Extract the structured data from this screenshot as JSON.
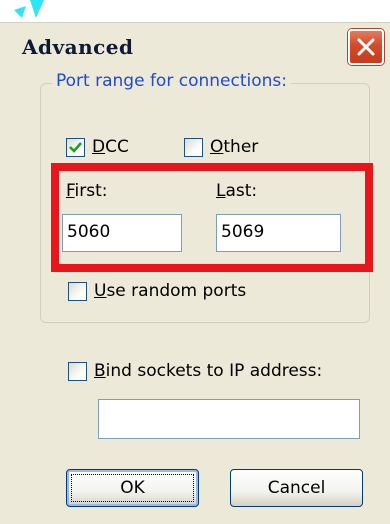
{
  "dialog": {
    "title": "Advanced"
  },
  "port_group": {
    "legend": "Port range for connections:",
    "dcc": {
      "prefix": "",
      "accel": "D",
      "rest": "CC",
      "checked": true
    },
    "other": {
      "accel": "O",
      "rest": "ther",
      "checked": false
    },
    "first": {
      "accel": "F",
      "rest": "irst:",
      "value": "5060"
    },
    "last": {
      "accel": "L",
      "rest": "ast:",
      "value": "5069"
    },
    "random": {
      "accel": "U",
      "rest": "se random ports",
      "checked": false
    }
  },
  "bind": {
    "accel": "B",
    "rest": "ind sockets to IP address:",
    "checked": false,
    "value": ""
  },
  "buttons": {
    "ok": "OK",
    "cancel": "Cancel"
  },
  "colors": {
    "highlight": "#e8161b",
    "legend": "#1f4bd1",
    "close": "#d34b2c"
  }
}
